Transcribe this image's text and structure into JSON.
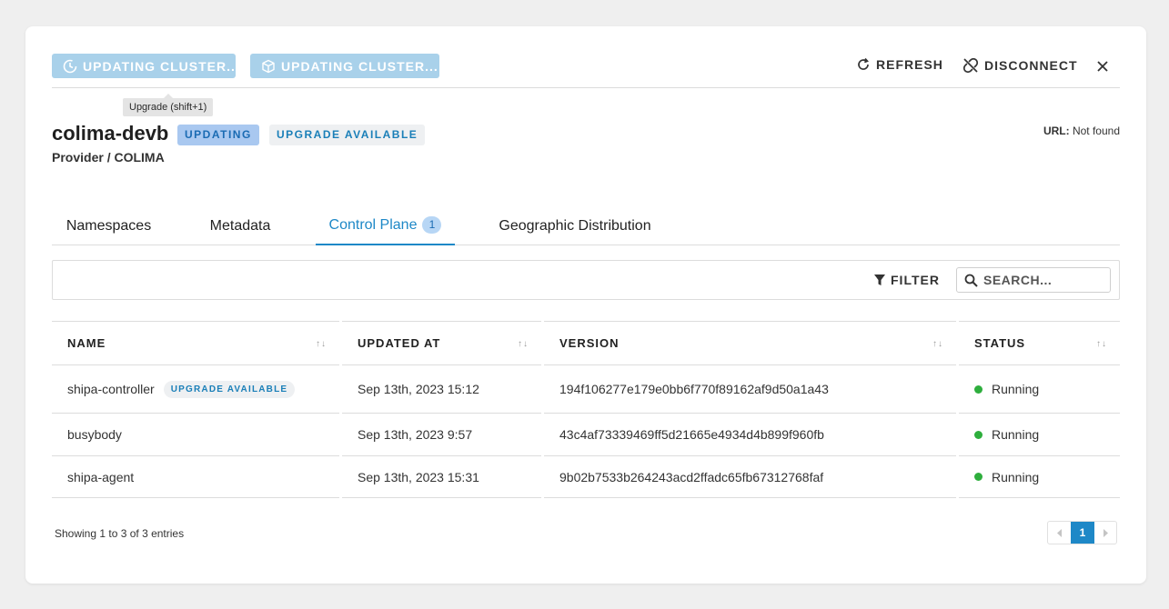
{
  "toolbar": {
    "upgrade_btn_1": "UPDATING CLUSTER..",
    "upgrade_btn_2": "UPDATING CLUSTER...",
    "tooltip": "Upgrade (shift+1)",
    "refresh": "REFRESH",
    "disconnect": "DISCONNECT"
  },
  "cluster": {
    "name": "colima-devb",
    "status_badge": "UPDATING",
    "upgrade_badge": "UPGRADE AVAILABLE",
    "provider": "Provider / COLIMA",
    "url_label": "URL:",
    "url_value": "Not found"
  },
  "tabs": [
    {
      "label": "Namespaces"
    },
    {
      "label": "Metadata"
    },
    {
      "label": "Control Plane",
      "count": "1"
    },
    {
      "label": "Geographic Distribution"
    }
  ],
  "filter": {
    "label": "FILTER",
    "search_placeholder": "SEARCH..."
  },
  "table": {
    "headers": [
      "NAME",
      "UPDATED AT",
      "VERSION",
      "STATUS"
    ],
    "rows": [
      {
        "name": "shipa-controller",
        "badge": "UPGRADE AVAILABLE",
        "updated": "Sep 13th, 2023 15:12",
        "version": "194f106277e179e0bb6f770f89162af9d50a1a43",
        "status": "Running"
      },
      {
        "name": "busybody",
        "updated": "Sep 13th, 2023 9:57",
        "version": "43c4af73339469ff5d21665e4934d4b899f960fb",
        "status": "Running"
      },
      {
        "name": "shipa-agent",
        "updated": "Sep 13th, 2023 15:31",
        "version": "9b02b7533b264243acd2ffadc65fb67312768faf",
        "status": "Running"
      }
    ]
  },
  "footer": {
    "entries": "Showing 1 to 3 of 3 entries",
    "page": "1"
  },
  "colors": {
    "accent": "#1e88c7",
    "status_running": "#2eae3d"
  }
}
